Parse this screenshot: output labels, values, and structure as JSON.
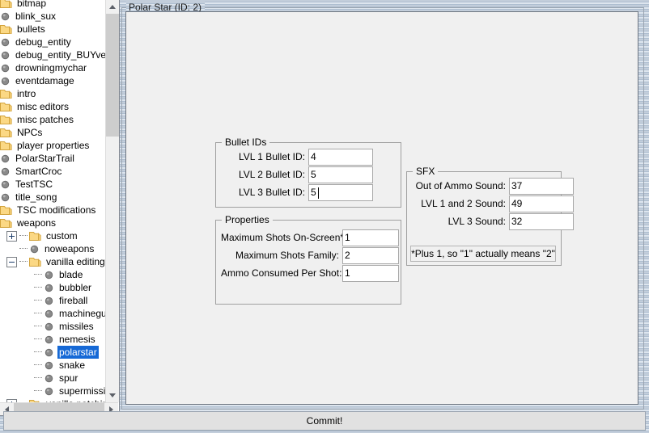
{
  "window": {
    "title": "Polar Star (ID: 2)"
  },
  "tree": {
    "items": [
      {
        "label": "bitmap",
        "icon": "folder-icon",
        "depth": 0,
        "expander": "none",
        "selected": false
      },
      {
        "label": "blink_sux",
        "icon": "node-sphere-icon",
        "depth": 0,
        "expander": "none",
        "selected": false
      },
      {
        "label": "bullets",
        "icon": "folder-icon",
        "depth": 0,
        "expander": "none",
        "selected": false
      },
      {
        "label": "debug_entity",
        "icon": "node-sphere-icon",
        "depth": 0,
        "expander": "none",
        "selected": false
      },
      {
        "label": "debug_entity_BUYversion",
        "icon": "node-sphere-icon",
        "depth": 0,
        "expander": "none",
        "selected": false
      },
      {
        "label": "drowningmychar",
        "icon": "node-sphere-icon",
        "depth": 0,
        "expander": "none",
        "selected": false
      },
      {
        "label": "eventdamage",
        "icon": "node-sphere-icon",
        "depth": 0,
        "expander": "none",
        "selected": false
      },
      {
        "label": "intro",
        "icon": "folder-icon",
        "depth": 0,
        "expander": "none",
        "selected": false
      },
      {
        "label": "misc editors",
        "icon": "folder-icon",
        "depth": 0,
        "expander": "none",
        "selected": false
      },
      {
        "label": "misc patches",
        "icon": "folder-icon",
        "depth": 0,
        "expander": "none",
        "selected": false
      },
      {
        "label": "NPCs",
        "icon": "folder-icon",
        "depth": 0,
        "expander": "none",
        "selected": false
      },
      {
        "label": "player properties",
        "icon": "folder-icon",
        "depth": 0,
        "expander": "none",
        "selected": false
      },
      {
        "label": "PolarStarTrail",
        "icon": "node-sphere-icon",
        "depth": 0,
        "expander": "none",
        "selected": false
      },
      {
        "label": "SmartCroc",
        "icon": "node-sphere-icon",
        "depth": 0,
        "expander": "none",
        "selected": false
      },
      {
        "label": "TestTSC",
        "icon": "node-sphere-icon",
        "depth": 0,
        "expander": "none",
        "selected": false
      },
      {
        "label": "title_song",
        "icon": "node-sphere-icon",
        "depth": 0,
        "expander": "none",
        "selected": false
      },
      {
        "label": "TSC modifications",
        "icon": "folder-icon",
        "depth": 0,
        "expander": "none",
        "selected": false
      },
      {
        "label": "weapons",
        "icon": "folder-icon",
        "depth": 0,
        "expander": "none",
        "selected": false
      },
      {
        "label": "custom",
        "icon": "folder-icon",
        "depth": 1,
        "expander": "plus",
        "selected": false
      },
      {
        "label": "noweapons",
        "icon": "node-sphere-icon",
        "depth": 1,
        "expander": "dot",
        "selected": false
      },
      {
        "label": "vanilla editing",
        "icon": "folder-icon",
        "depth": 1,
        "expander": "minus",
        "selected": false
      },
      {
        "label": "blade",
        "icon": "node-sphere-icon",
        "depth": 2,
        "expander": "dot",
        "selected": false
      },
      {
        "label": "bubbler",
        "icon": "node-sphere-icon",
        "depth": 2,
        "expander": "dot",
        "selected": false
      },
      {
        "label": "fireball",
        "icon": "node-sphere-icon",
        "depth": 2,
        "expander": "dot",
        "selected": false
      },
      {
        "label": "machinegun",
        "icon": "node-sphere-icon",
        "depth": 2,
        "expander": "dot",
        "selected": false
      },
      {
        "label": "missiles",
        "icon": "node-sphere-icon",
        "depth": 2,
        "expander": "dot",
        "selected": false
      },
      {
        "label": "nemesis",
        "icon": "node-sphere-icon",
        "depth": 2,
        "expander": "dot",
        "selected": false
      },
      {
        "label": "polarstar",
        "icon": "node-sphere-icon",
        "depth": 2,
        "expander": "dot",
        "selected": true
      },
      {
        "label": "snake",
        "icon": "node-sphere-icon",
        "depth": 2,
        "expander": "dot",
        "selected": false
      },
      {
        "label": "spur",
        "icon": "node-sphere-icon",
        "depth": 2,
        "expander": "dot",
        "selected": false
      },
      {
        "label": "supermissiles",
        "icon": "node-sphere-icon",
        "depth": 2,
        "expander": "dot",
        "selected": false
      },
      {
        "label": "vanilla patching",
        "icon": "folder-icon",
        "depth": 1,
        "expander": "plus",
        "selected": false
      }
    ]
  },
  "bullet_ids": {
    "title": "Bullet IDs",
    "fields": [
      {
        "label": "LVL 1 Bullet ID:",
        "value": "4",
        "focused": false
      },
      {
        "label": "LVL 2 Bullet ID:",
        "value": "5",
        "focused": false
      },
      {
        "label": "LVL 3 Bullet ID:",
        "value": "5",
        "focused": true
      }
    ]
  },
  "properties": {
    "title": "Properties",
    "fields": [
      {
        "label": "Maximum Shots On-Screen*:",
        "value": "1",
        "focused": false
      },
      {
        "label": "Maximum Shots Family:",
        "value": "2",
        "focused": false
      },
      {
        "label": "Ammo Consumed Per Shot:",
        "value": "1",
        "focused": false
      }
    ]
  },
  "sfx": {
    "title": "SFX",
    "fields": [
      {
        "label": "Out of Ammo Sound:",
        "value": "37",
        "focused": false
      },
      {
        "label": "LVL 1 and 2 Sound:",
        "value": "49",
        "focused": false
      },
      {
        "label": "LVL 3 Sound:",
        "value": "32",
        "focused": false
      }
    ],
    "note": "*Plus 1, so \"1\" actually means \"2\""
  },
  "commit": {
    "label": "Commit!"
  },
  "colors": {
    "selection": "#1669d6",
    "folder": "#ffd782",
    "panel": "#f0f0f0",
    "frame": "#9aa4b0"
  }
}
